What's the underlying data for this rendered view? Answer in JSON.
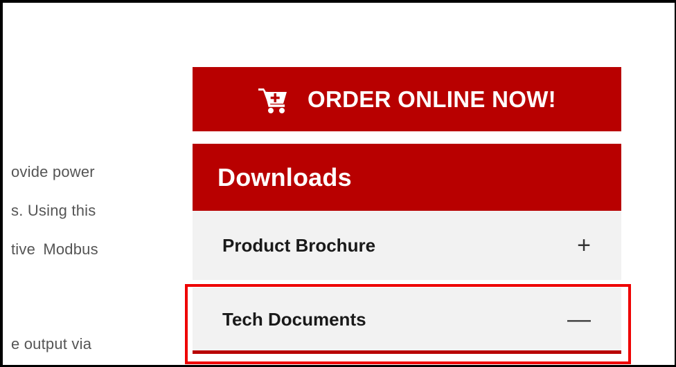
{
  "body_text": {
    "line1": "ovide power",
    "line2": "s. Using this",
    "line3": "tive Modbus",
    "line4": "e output via"
  },
  "order_button": {
    "label": "ORDER ONLINE NOW!",
    "icon": "cart-plus-icon"
  },
  "downloads": {
    "title": "Downloads",
    "items": [
      {
        "label": "Product Brochure",
        "toggle": "+",
        "state": "collapsed"
      },
      {
        "label": "Tech Documents",
        "toggle": "—",
        "state": "expanded"
      }
    ]
  },
  "colors": {
    "brand_red": "#b80000",
    "highlight_red": "#ee0000",
    "accordion_bg": "#f2f2f2"
  }
}
